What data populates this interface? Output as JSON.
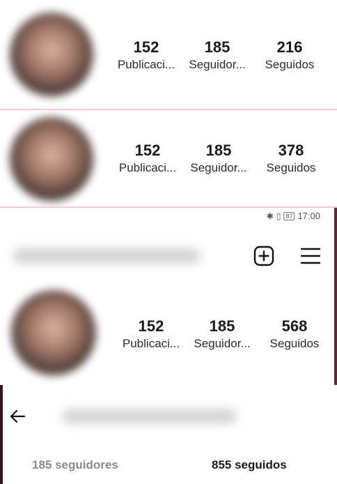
{
  "profiles": [
    {
      "stats": [
        {
          "number": "152",
          "label": "Publicaci..."
        },
        {
          "number": "185",
          "label": "Seguidor..."
        },
        {
          "number": "216",
          "label": "Seguidos"
        }
      ]
    },
    {
      "stats": [
        {
          "number": "152",
          "label": "Publicaci..."
        },
        {
          "number": "185",
          "label": "Seguidor..."
        },
        {
          "number": "378",
          "label": "Seguidos"
        }
      ]
    },
    {
      "stats": [
        {
          "number": "152",
          "label": "Publicaci..."
        },
        {
          "number": "185",
          "label": "Seguidor..."
        },
        {
          "number": "568",
          "label": "Seguidos"
        }
      ]
    }
  ],
  "status_bar": {
    "battery": "87",
    "time": "17:00"
  },
  "header_icons": {
    "add": "add-square-icon",
    "menu": "hamburger-menu-icon"
  },
  "follow_view": {
    "back_icon": "arrow-left-icon",
    "followers_tab": "185 seguidores",
    "following_tab": "855 seguidos"
  },
  "colors": {
    "divider": "#f2c9d8",
    "frame": "#3a1220"
  }
}
